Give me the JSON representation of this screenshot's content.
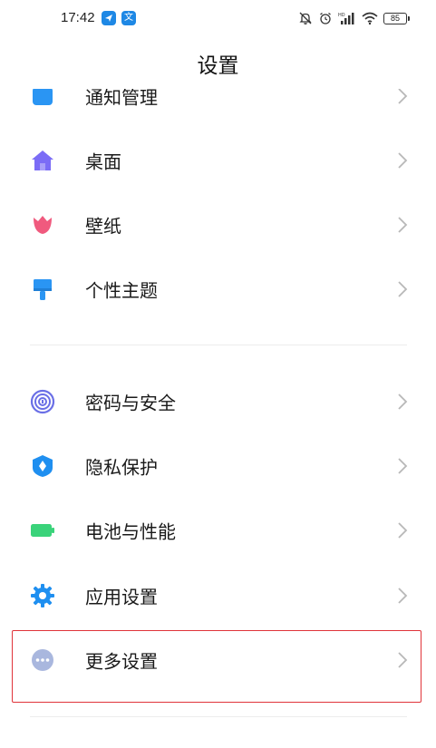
{
  "status_bar": {
    "time": "17:42",
    "app_icon_1": "paper-plane-icon",
    "app_icon_2": "文",
    "battery": "85"
  },
  "header": {
    "title": "设置"
  },
  "list": {
    "items": [
      {
        "label": "通知管理",
        "icon": "notification-icon"
      },
      {
        "label": "桌面",
        "icon": "home-icon"
      },
      {
        "label": "壁纸",
        "icon": "tulip-icon"
      },
      {
        "label": "个性主题",
        "icon": "paint-brush-icon"
      },
      {
        "label": "密码与安全",
        "icon": "fingerprint-icon"
      },
      {
        "label": "隐私保护",
        "icon": "privacy-shield-icon"
      },
      {
        "label": "电池与性能",
        "icon": "battery-icon"
      },
      {
        "label": "应用设置",
        "icon": "gear-icon"
      },
      {
        "label": "更多设置",
        "icon": "more-dots-icon"
      }
    ]
  },
  "colors": {
    "highlight": "#e0343a",
    "home": "#7b6cf6",
    "tulip": "#f05a7e",
    "brush": "#2a95f3",
    "fingerprint": "#6a6fe6",
    "shield": "#1f8ff0",
    "battery": "#3ad37a",
    "gear": "#1f8ff0",
    "more": "#a9b7de"
  }
}
